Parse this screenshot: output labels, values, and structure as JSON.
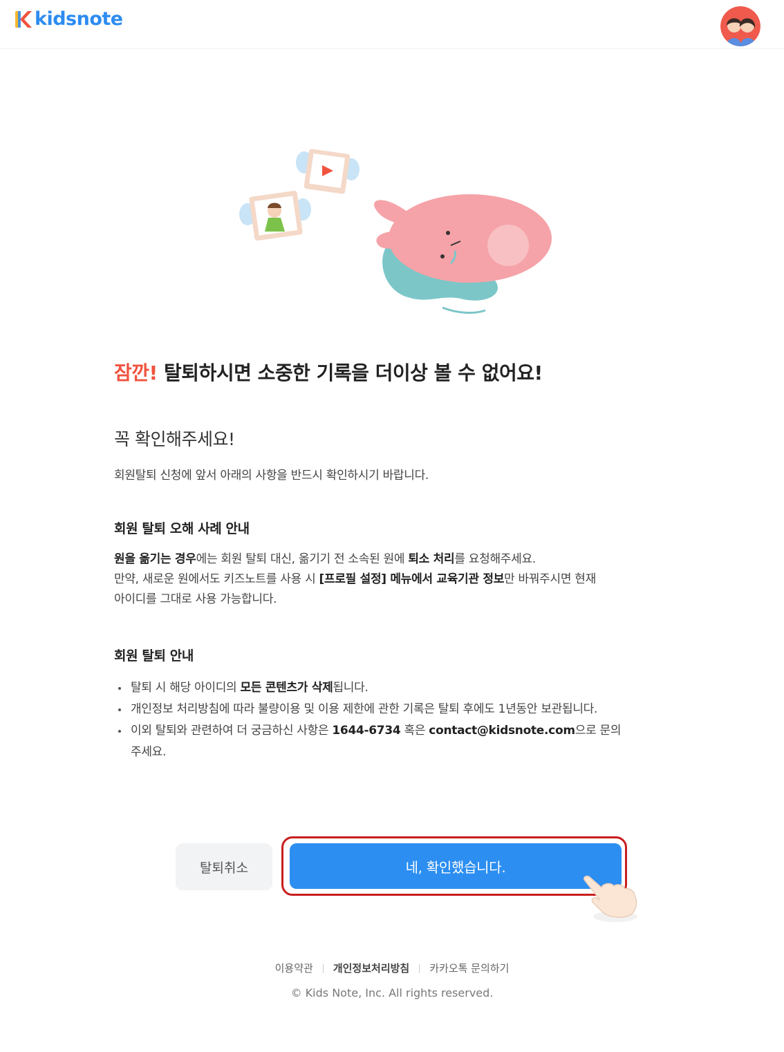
{
  "header": {
    "logo_text": "kidsnote",
    "brand_color": "#2d8cf0",
    "avatar_icon": "parents-avatar-icon"
  },
  "hero": {
    "illustration": "sad-pink-bunny-with-photo-frames"
  },
  "headline": {
    "accent": "잠깐!",
    "rest": " 탈퇴하시면 소중한 기록을 더이상 볼 수 없어요!",
    "accent_color": "#f0533f"
  },
  "notice": {
    "title": "꼭 확인해주세요!",
    "intro": "회원탈퇴 신청에 앞서 아래의 사항을 반드시 확인하시기 바랍니다."
  },
  "misunderstanding": {
    "title": "회원 탈퇴 오해 사례 안내",
    "l1_b1": "원을 옮기는 경우",
    "l1_t1": "에는 회원 탈퇴 대신, 옮기기 전 소속된 원에 ",
    "l1_b2": "퇴소 처리",
    "l1_t2": "를 요청해주세요.",
    "l2_t1": "만약, 새로운 원에서도 키즈노트를 사용 시 ",
    "l2_b1": "[프로필 설정] 메뉴에서 교육기관 정보",
    "l2_t2": "만 바꿔주시면 현재",
    "l3": "아이디를 그대로 사용 가능합니다."
  },
  "withdrawal": {
    "title": "회원 탈퇴 안내",
    "b1_t1": "탈퇴 시 해당 아이디의 ",
    "b1_b1": "모든 콘텐츠가 삭제",
    "b1_t2": "됩니다.",
    "b2": "개인정보 처리방침에 따라 불량이용 및 이용 제한에 관한 기록은 탈퇴 후에도 1년동안 보관됩니다.",
    "b3_t1": "이외 탈퇴와 관련하여 더 궁금하신 사항은 ",
    "b3_phone": "1644-6734",
    "b3_t2": " 혹은 ",
    "b3_email": "contact@kidsnote.com",
    "b3_t3": "으로 문의",
    "b3_t4": "주세요."
  },
  "buttons": {
    "cancel": "탈퇴취소",
    "confirm": "네, 확인했습니다.",
    "confirm_color": "#2c8ef1",
    "highlight_color": "#c81e1e"
  },
  "footer": {
    "terms": "이용약관",
    "privacy": "개인정보처리방침",
    "kakao": "카카오톡 문의하기",
    "copyright": "© Kids Note, Inc. All rights reserved."
  }
}
